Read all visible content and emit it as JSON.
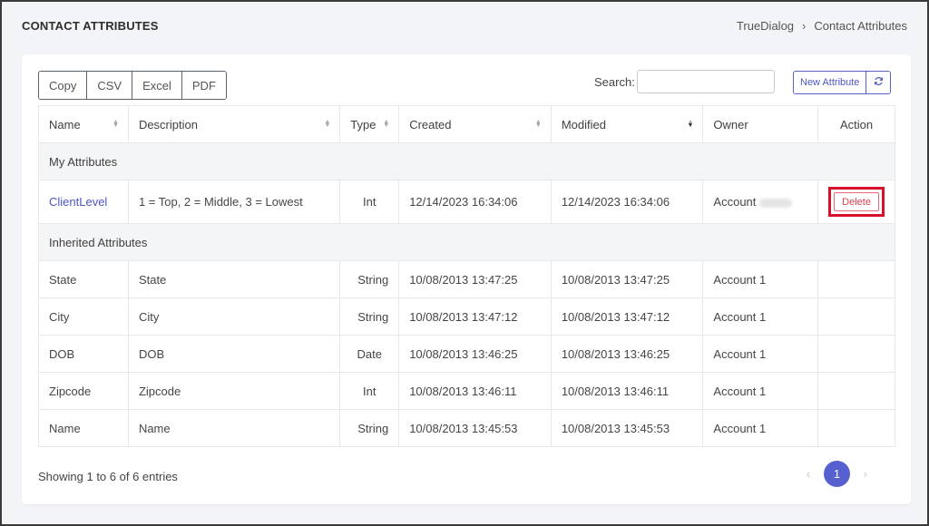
{
  "header": {
    "title": "CONTACT ATTRIBUTES",
    "breadcrumb": [
      "TrueDialog",
      "Contact Attributes"
    ],
    "breadcrumb_separator": "›"
  },
  "toolbar": {
    "export_buttons": [
      "Copy",
      "CSV",
      "Excel",
      "PDF"
    ],
    "search_label": "Search:",
    "search_value": "",
    "new_attribute_label": "New Attribute",
    "refresh_icon": "refresh-icon"
  },
  "table": {
    "columns": [
      "Name",
      "Description",
      "Type",
      "Created",
      "Modified",
      "Owner",
      "Action"
    ],
    "groups": [
      {
        "label": "My Attributes",
        "rows": [
          {
            "name": "ClientLevel",
            "description": "1 = Top, 2 = Middle, 3 = Lowest",
            "type": "Int",
            "created": "12/14/2023 16:34:06",
            "modified": "12/14/2023 16:34:06",
            "owner": "Account",
            "action": "Delete"
          }
        ]
      },
      {
        "label": "Inherited Attributes",
        "rows": [
          {
            "name": "State",
            "description": "State",
            "type": "String",
            "created": "10/08/2013 13:47:25",
            "modified": "10/08/2013 13:47:25",
            "owner": "Account 1"
          },
          {
            "name": "City",
            "description": "City",
            "type": "String",
            "created": "10/08/2013 13:47:12",
            "modified": "10/08/2013 13:47:12",
            "owner": "Account 1"
          },
          {
            "name": "DOB",
            "description": "DOB",
            "type": "Date",
            "created": "10/08/2013 13:46:25",
            "modified": "10/08/2013 13:46:25",
            "owner": "Account 1"
          },
          {
            "name": "Zipcode",
            "description": "Zipcode",
            "type": "Int",
            "created": "10/08/2013 13:46:11",
            "modified": "10/08/2013 13:46:11",
            "owner": "Account 1"
          },
          {
            "name": "Name",
            "description": "Name",
            "type": "String",
            "created": "10/08/2013 13:45:53",
            "modified": "10/08/2013 13:45:53",
            "owner": "Account 1"
          }
        ]
      }
    ]
  },
  "footer": {
    "info": "Showing 1 to 6 of 6 entries",
    "prev": "‹",
    "current_page": "1",
    "next": "›"
  },
  "colors": {
    "accent": "#5760cf",
    "delete_highlight": "#d8102a",
    "link": "#4d56c4"
  }
}
